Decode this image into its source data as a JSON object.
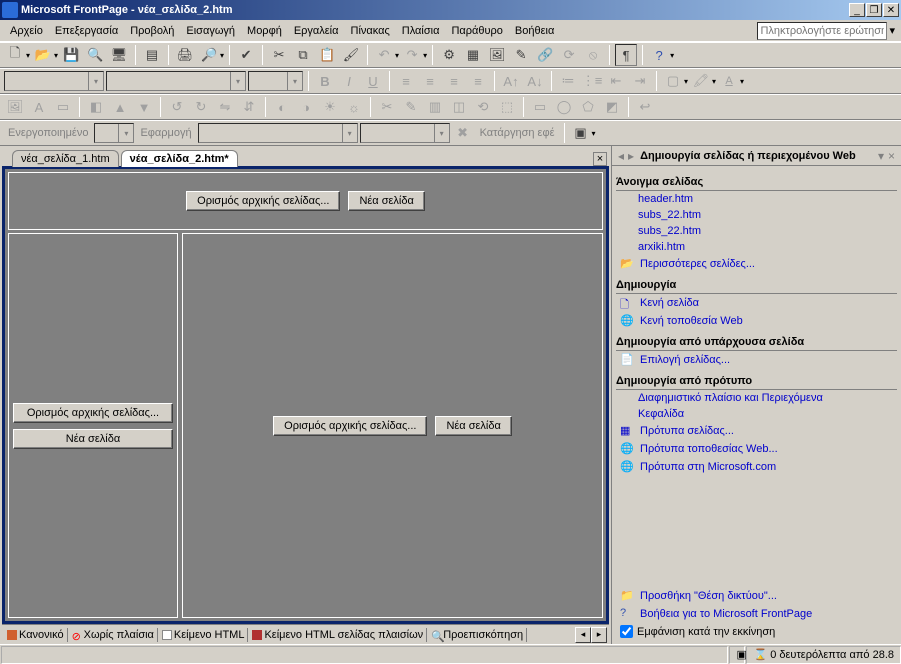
{
  "window": {
    "title": "Microsoft FrontPage - νέα_σελίδα_2.htm"
  },
  "menu": {
    "items": [
      "Αρχείο",
      "Επεξεργασία",
      "Προβολή",
      "Εισαγωγή",
      "Μορφή",
      "Εργαλεία",
      "Πίνακας",
      "Πλαίσια",
      "Παράθυρο",
      "Βοήθεια"
    ],
    "ask_placeholder": "Πληκτρολογήστε ερώτηση"
  },
  "formatbar": {
    "label_active": "Ενεργοποιημένο",
    "label_apply": "Εφαρμογή",
    "btn_cancel": "Κατάργηση εφέ"
  },
  "tabs": {
    "doc1": "νέα_σελίδα_1.htm",
    "doc2": "νέα_σελίδα_2.htm*"
  },
  "frame": {
    "btn_set_initial": "Ορισμός αρχικής σελίδας...",
    "btn_new_page": "Νέα σελίδα"
  },
  "views": {
    "normal": "Κανονικό",
    "noframes": "Χωρίς πλαίσια",
    "html": "Κείμενο HTML",
    "frames_html": "Κείμενο HTML σελίδας πλαισίων",
    "preview": "Προεπισκόπηση"
  },
  "taskpane": {
    "title": "Δημιουργία σελίδας ή περιεχομένου Web",
    "sec_open": "Άνοιγμα σελίδας",
    "open_files": [
      "header.htm",
      "subs_22.htm",
      "subs_22.htm",
      "arxiki.htm"
    ],
    "more_pages": "Περισσότερες σελίδες...",
    "sec_create": "Δημιουργία",
    "blank_page": "Κενή σελίδα",
    "blank_web": "Κενή τοποθεσία Web",
    "sec_existing": "Δημιουργία από υπάρχουσα σελίδα",
    "choose_page": "Επιλογή σελίδας...",
    "sec_template": "Δημιουργία από πρότυπο",
    "tpl_banner": "Διαφημιστικό πλαίσιο και Περιεχόμενα",
    "tpl_header": "Κεφαλίδα",
    "tpl_page": "Πρότυπα σελίδας...",
    "tpl_web": "Πρότυπα τοποθεσίας Web...",
    "tpl_ms": "Πρότυπα στη Microsoft.com",
    "add_net": "Προσθήκη \"Θέση δικτύου\"...",
    "help": "Βοήθεια για το Microsoft FrontPage",
    "show_startup": "Εμφάνιση κατά την εκκίνηση"
  },
  "status": {
    "seconds": "0 δευτερόλεπτα από 28.8"
  }
}
